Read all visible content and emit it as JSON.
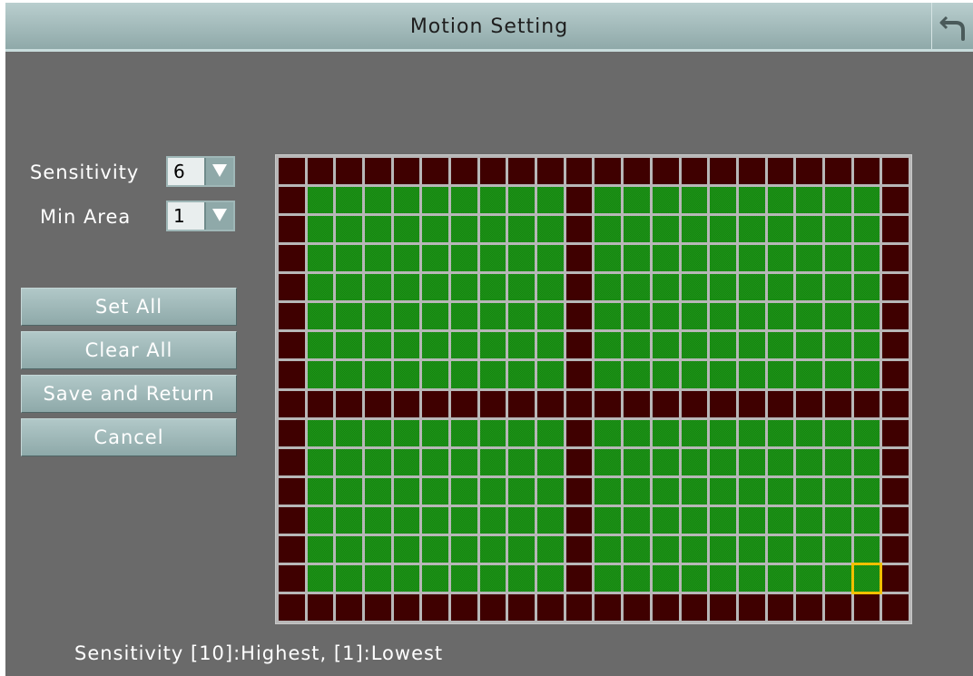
{
  "window": {
    "title": "Motion Setting",
    "back_icon": "return-arrow-icon"
  },
  "controls": {
    "sensitivity": {
      "label": "Sensitivity",
      "value": "6"
    },
    "min_area": {
      "label": "Min Area",
      "value": "1"
    }
  },
  "buttons": {
    "set_all": "Set All",
    "clear_all": "Clear All",
    "save_return": "Save and Return",
    "cancel": "Cancel"
  },
  "hint": "Sensitivity [10]:Highest, [1]:Lowest",
  "grid": {
    "columns": 22,
    "rows": 16,
    "cells": [
      "0000000000000000000000",
      "0111111111011111111110",
      "0111111111011111111110",
      "0111111111011111111110",
      "0111111111011111111110",
      "0111111111011111111110",
      "0111111111011111111110",
      "0111111111011111111110",
      "0000000000000000000000",
      "0111111111011111111110",
      "0111111111011111111110",
      "0111111111011111111110",
      "0111111111011111111110",
      "0111111111011111111110",
      "0111111111011111111110",
      "0000000000000000000000"
    ],
    "cursor": {
      "row": 14,
      "col": 20
    },
    "colors": {
      "active": "#1c9a16",
      "inactive": "#3f0000",
      "cursor": "#f0c000"
    }
  }
}
